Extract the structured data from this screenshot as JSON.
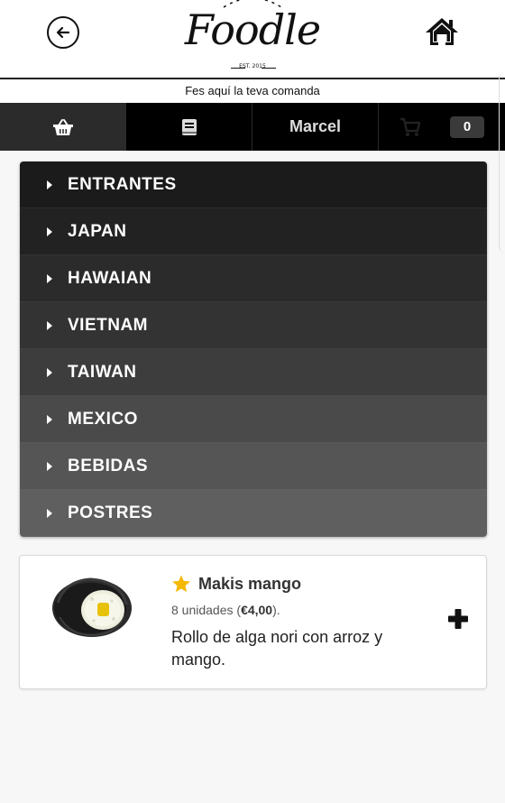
{
  "header": {
    "logo_text": "Foodle",
    "logo_est": "EST. 2015",
    "back_icon": "arrow-left-circle-icon",
    "home_icon": "home-icon"
  },
  "subtitle": "Fes aquí la teva comanda",
  "navbar": {
    "shop_icon": "basket-icon",
    "orders_icon": "book-icon",
    "user_name": "Marcel",
    "cart_icon": "cart-icon",
    "cart_count": "0"
  },
  "menu": {
    "items": [
      {
        "label": "ENTRANTES",
        "color": "#1b1b1b"
      },
      {
        "label": "JAPAN",
        "color": "#222222"
      },
      {
        "label": "HAWAIAN",
        "color": "#2b2b2b"
      },
      {
        "label": "VIETNAM",
        "color": "#333333"
      },
      {
        "label": "TAIWAN",
        "color": "#3d3d3d"
      },
      {
        "label": "MEXICO",
        "color": "#4a4a4a"
      },
      {
        "label": "BEBIDAS",
        "color": "#555555"
      },
      {
        "label": "POSTRES",
        "color": "#5f5f5f"
      }
    ]
  },
  "product": {
    "name": "Makis mango",
    "units": "8 unidades (",
    "price": "€4,00",
    "units_end": ").",
    "description": "Rollo de alga nori con arroz y mango.",
    "star_color": "#f5b800",
    "add_icon": "plus-icon"
  }
}
